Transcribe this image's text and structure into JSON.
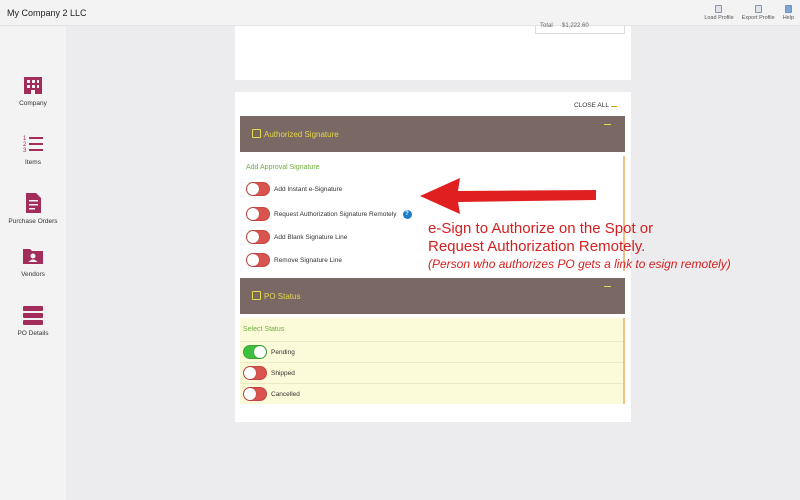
{
  "app": {
    "title": "My Company 2 LLC"
  },
  "top_actions": [
    {
      "label": "Load Profile",
      "icon": "load-profile-icon"
    },
    {
      "label": "Export Profile",
      "icon": "export-profile-icon"
    },
    {
      "label": "Help",
      "icon": "help-icon"
    }
  ],
  "sidebar": {
    "accent": "#a32d5a",
    "items": [
      {
        "label": "Company",
        "icon": "building-icon"
      },
      {
        "label": "Items",
        "icon": "numbered-list-icon"
      },
      {
        "label": "Purchase Orders",
        "icon": "document-icon"
      },
      {
        "label": "Vendors",
        "icon": "vendor-folder-icon"
      },
      {
        "label": "PO Details",
        "icon": "server-stack-icon"
      }
    ]
  },
  "summary": {
    "total_label": "Total",
    "total_value": "$1,222.60"
  },
  "close_all": "CLOSE ALL",
  "authorized_signature": {
    "title": "Authorized Signature",
    "section_label": "Add Approval Signature",
    "options": [
      {
        "label": "Add Instant e-Signature",
        "on": false
      },
      {
        "label": "Request Authorization Signature Remotely",
        "on": false,
        "help": "?"
      },
      {
        "label": "Add Blank Signature Line",
        "on": false
      },
      {
        "label": "Remove Signature Line",
        "on": false
      }
    ]
  },
  "po_status": {
    "title": "PO Status",
    "section_label": "Select Status",
    "options": [
      {
        "label": "Pending",
        "on": true
      },
      {
        "label": "Shipped",
        "on": false
      },
      {
        "label": "Cancelled",
        "on": false
      }
    ]
  },
  "annotation": {
    "line1": "e-Sign to Authorize on the Spot or",
    "line2": "Request Authorization Remotely.",
    "line3": "(Person who authorizes PO gets a link  to esign remotely)",
    "color": "#d42020"
  }
}
